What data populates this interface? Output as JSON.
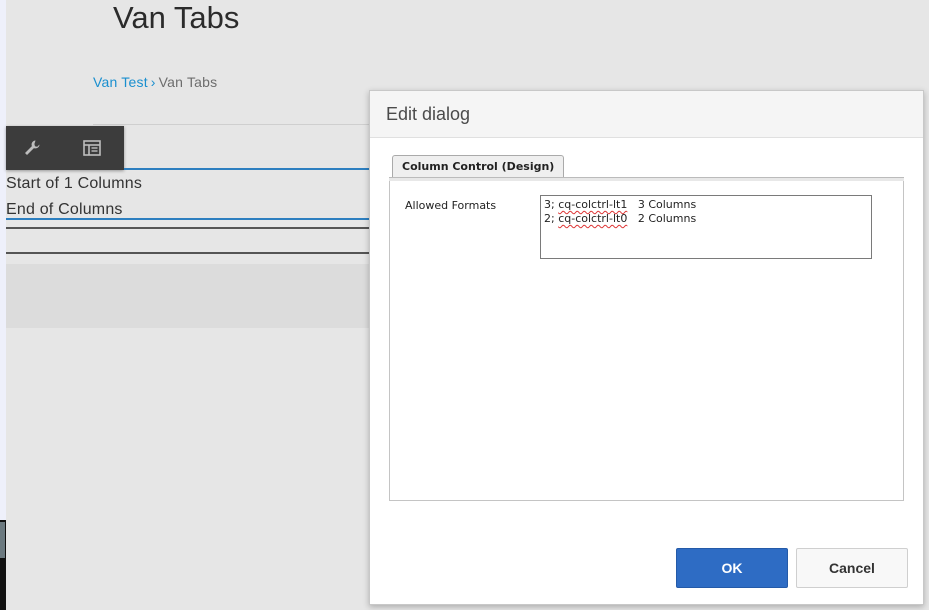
{
  "page": {
    "title": "Van Tabs"
  },
  "breadcrumb": {
    "parent": "Van Test",
    "separator": "›",
    "current": "Van Tabs"
  },
  "toolbar": {
    "icons": [
      "wrench-icon",
      "layout-icon"
    ]
  },
  "content": {
    "columns_start": "Start of 1 Columns",
    "columns_end": "End of Columns"
  },
  "dialog": {
    "title": "Edit dialog",
    "tab_label": "Column Control (Design)",
    "field_label": "Allowed Formats",
    "formats": [
      {
        "prefix": "3; ",
        "class": "cq-colctrl-lt1",
        "suffix": "   3 Columns"
      },
      {
        "prefix": "2; ",
        "class": "cq-colctrl-lt0",
        "suffix": "   2 Columns"
      }
    ],
    "ok_label": "OK",
    "cancel_label": "Cancel"
  },
  "colors": {
    "accent_blue": "#2e6cc4",
    "link_blue": "#1a8fcf",
    "toolbar_dark": "#3c3c3c",
    "page_background": "#e6e6e6"
  }
}
